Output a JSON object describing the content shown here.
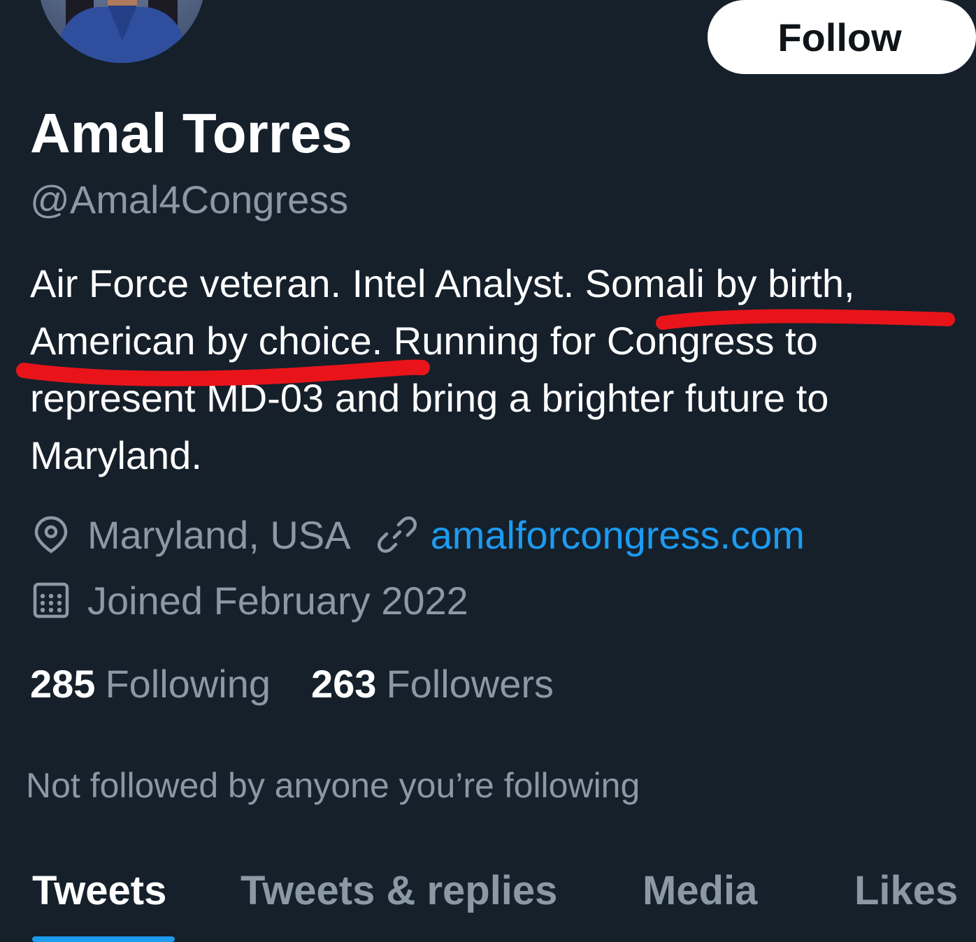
{
  "profile": {
    "name": "Amal Torres",
    "handle": "@Amal4Congress",
    "bio_lines": [
      "Air Force veteran. Intel Analyst. Somali by birth,",
      "American by choice. Running for Congress to",
      "represent MD-03 and bring a brighter future to",
      "Maryland."
    ],
    "location": "Maryland, USA",
    "website": "amalforcongress.com",
    "joined": "Joined February 2022",
    "following_count": "285",
    "following_label": "Following",
    "followers_count": "263",
    "followers_label": "Followers",
    "not_followed_text": "Not followed by anyone you’re following"
  },
  "actions": {
    "follow_label": "Follow"
  },
  "tabs": [
    {
      "label": "Tweets",
      "active": true
    },
    {
      "label": "Tweets & replies",
      "active": false
    },
    {
      "label": "Media",
      "active": false
    },
    {
      "label": "Likes",
      "active": false
    }
  ],
  "icons": {
    "location": "location-pin-icon",
    "link": "link-icon",
    "calendar": "calendar-icon"
  },
  "colors": {
    "background": "#15202b",
    "primary_text": "#ffffff",
    "secondary_text": "#8b98a5",
    "accent": "#1d9bf0",
    "annotation_red": "#e8141a"
  }
}
